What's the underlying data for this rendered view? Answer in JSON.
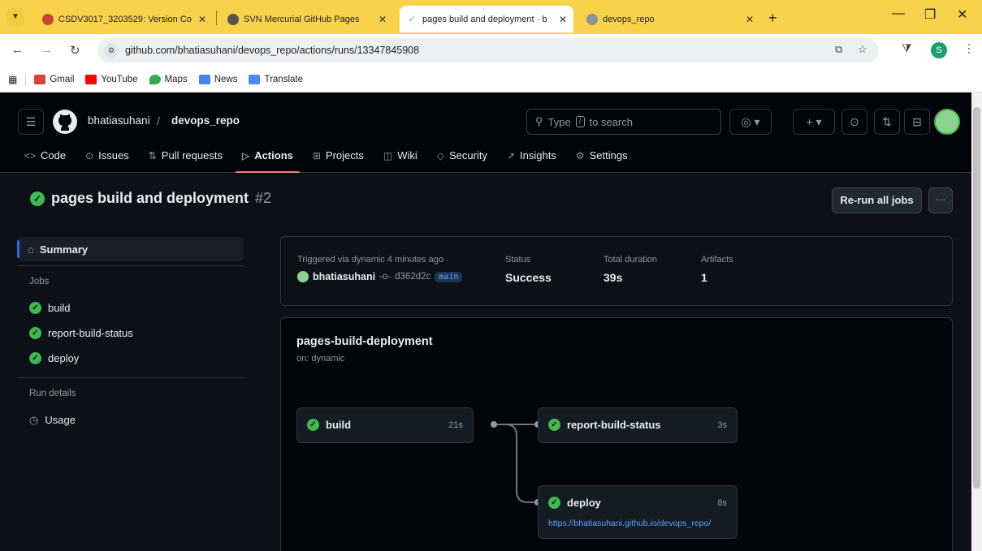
{
  "browser": {
    "tabs": [
      {
        "title": "CSDV3017_3203529: Version Co",
        "active": false
      },
      {
        "title": "SVN Mercurial GitHub Pages",
        "active": false
      },
      {
        "title": "pages build and deployment · b",
        "active": true
      },
      {
        "title": "devops_repo",
        "active": false
      }
    ],
    "new_tab": "+",
    "url": "github.com/bhatiasuhani/devops_repo/actions/runs/13347845908",
    "profile_initial": "S",
    "bookmarks": [
      "Gmail",
      "YouTube",
      "Maps",
      "News",
      "Translate"
    ]
  },
  "repo": {
    "owner": "bhatiasuhani",
    "separator": "/",
    "name": "devops_repo",
    "search_placeholder": "Type",
    "search_key": "/",
    "search_suffix": "to search",
    "nav": [
      {
        "label": "Code",
        "icon": "code-icon",
        "glyph": "<>"
      },
      {
        "label": "Issues",
        "icon": "issue-icon",
        "glyph": "⊙"
      },
      {
        "label": "Pull requests",
        "icon": "pull-request-icon",
        "glyph": "⇅"
      },
      {
        "label": "Actions",
        "icon": "play-icon",
        "glyph": "▷",
        "selected": true
      },
      {
        "label": "Projects",
        "icon": "table-icon",
        "glyph": "⊞"
      },
      {
        "label": "Wiki",
        "icon": "book-icon",
        "glyph": "◫"
      },
      {
        "label": "Security",
        "icon": "shield-icon",
        "glyph": "◇"
      },
      {
        "label": "Insights",
        "icon": "graph-icon",
        "glyph": "↗"
      },
      {
        "label": "Settings",
        "icon": "gear-icon",
        "glyph": "⚙"
      }
    ]
  },
  "run": {
    "title": "pages build and deployment",
    "number": "#2",
    "rerun_label": "Re-run all jobs",
    "more_label": "···"
  },
  "sidebar": {
    "summary_label": "Summary",
    "jobs_heading": "Jobs",
    "jobs": [
      "build",
      "report-build-status",
      "deploy"
    ],
    "run_details_heading": "Run details",
    "usage_label": "Usage"
  },
  "summary": {
    "triggered_label": "Triggered via dynamic 4 minutes ago",
    "actor": "bhatiasuhani",
    "commit": "d362d2c",
    "branch": "main",
    "status_label": "Status",
    "status_value": "Success",
    "duration_label": "Total duration",
    "duration_value": "39s",
    "artifacts_label": "Artifacts",
    "artifacts_value": "1"
  },
  "workflow": {
    "name": "pages-build-deployment",
    "trigger": "on: dynamic",
    "jobs": {
      "build": {
        "name": "build",
        "time": "21s"
      },
      "report": {
        "name": "report-build-status",
        "time": "3s"
      },
      "deploy": {
        "name": "deploy",
        "time": "8s",
        "link": "https://bhatiasuhani.github.io/devops_repo/"
      }
    }
  },
  "colors": {
    "success": "#3fb950",
    "accent_underline": "#f78166",
    "link": "#58a6ff",
    "tabbar": "#f8d34a"
  }
}
